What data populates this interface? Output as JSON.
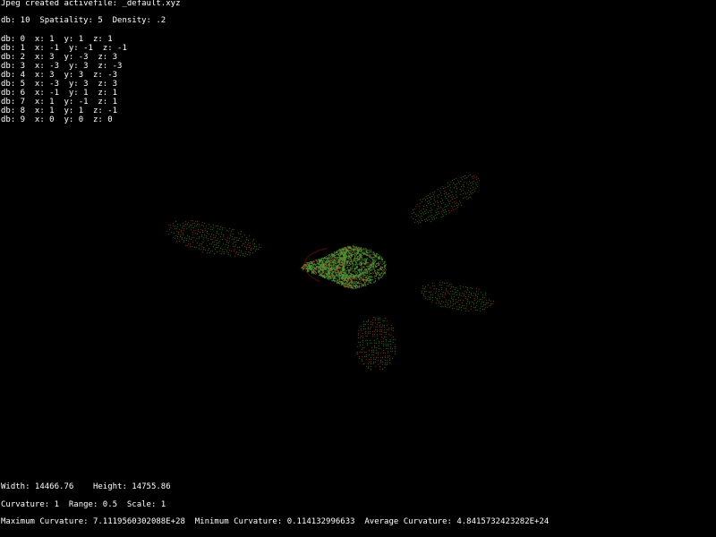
{
  "window": {
    "status": "Jpeg created activefile: _default.xyz",
    "params": "db: 10  Spatiality: 5  Density: .2"
  },
  "db_entries": [
    {
      "db": "0",
      "x": "1",
      "y": "1",
      "z": "1"
    },
    {
      "db": "1",
      "x": "-1",
      "y": "-1",
      "z": "-1"
    },
    {
      "db": "2",
      "x": "3",
      "y": "-3",
      "z": "3"
    },
    {
      "db": "3",
      "x": "-3",
      "y": "3",
      "z": "-3"
    },
    {
      "db": "4",
      "x": "3",
      "y": "3",
      "z": "-3"
    },
    {
      "db": "5",
      "x": "-3",
      "y": "3",
      "z": "3"
    },
    {
      "db": "6",
      "x": "-1",
      "y": "1",
      "z": "1"
    },
    {
      "db": "7",
      "x": "1",
      "y": "-1",
      "z": "1"
    },
    {
      "db": "8",
      "x": "1",
      "y": "1",
      "z": "-1"
    },
    {
      "db": "9",
      "x": "0",
      "y": "0",
      "z": "0"
    }
  ],
  "dimensions": "Width: 14466.76    Height: 14755.86",
  "settings": "Curvature: 1  Range: 0.5  Scale: 1",
  "curvature_stats": "Maximum Curvature: 7.1119560302088E+28  Minimum Curvature: 0.114132996633  Average Curvature: 4.8415732423282E+24",
  "colors": {
    "background": "#000000",
    "text": "#ffffff",
    "point_green": "#2e8b2e",
    "point_red": "#b03020",
    "point_olive": "#6b7a30"
  }
}
